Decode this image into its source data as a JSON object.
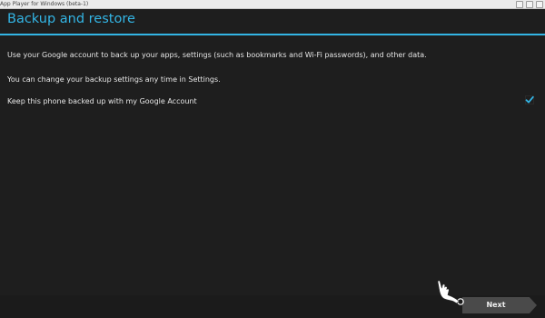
{
  "window": {
    "title": "App Player for Windows (beta-1)"
  },
  "header": {
    "title": "Backup and restore",
    "accent_color": "#33b5e5"
  },
  "content": {
    "description": "Use your Google account to back up your apps, settings (such as bookmarks and Wi-Fi passwords), and other data.",
    "note": "You can change your backup settings any time in Settings.",
    "backup_option": {
      "label": "Keep this phone backed up with my Google Account",
      "checked": true
    }
  },
  "footer": {
    "next_label": "Next"
  },
  "icons": {
    "checkbox": "checkmark-icon",
    "pointer": "hand-pointer-icon"
  }
}
